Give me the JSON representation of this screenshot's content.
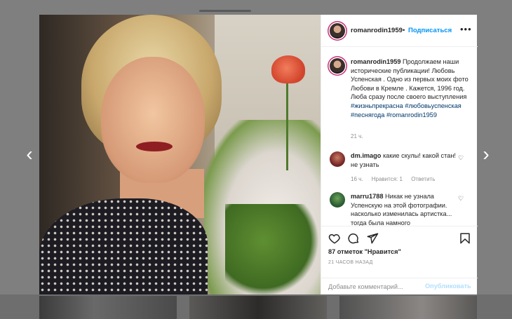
{
  "post": {
    "username": "romanrodin1959",
    "follow_label": "Подписаться",
    "dot": "•",
    "more_label": "•••"
  },
  "caption": {
    "username": "romanrodin1959",
    "text": "Продолжаем наши исторические публикации! Любовь Успенская . Одно из первых моих фото Любови в Кремле . Кажется, 1996 год. Люба сразу после своего выступления",
    "hashtags": [
      "#жизньпрекрасна",
      "#любовьуспенская",
      "#песнягода",
      "#romanrodin1959"
    ],
    "time": "21 ч."
  },
  "comments": [
    {
      "username": "dm.imago",
      "text": "какие скулы! какой стан! не узнать",
      "time": "16 ч.",
      "likes": "Нравится: 1",
      "reply": "Ответить"
    },
    {
      "username": "marru1788",
      "text": "Никак не узнала Успенскую на этой фотографии. насколько изменилась артистка... тогда была намного",
      "time": "",
      "likes": "",
      "reply": ""
    }
  ],
  "actions": {
    "likes_text": "87 отметок \"Нравится\"",
    "time_ago": "21 часов назад"
  },
  "comment_box": {
    "placeholder": "Добавьте комментарий...",
    "publish_label": "Опубликовать"
  },
  "nav": {
    "prev": "‹",
    "next": "›"
  },
  "colors": {
    "accent": "#0095f6",
    "hashtag": "#00376b",
    "muted": "#8e8e8e"
  }
}
